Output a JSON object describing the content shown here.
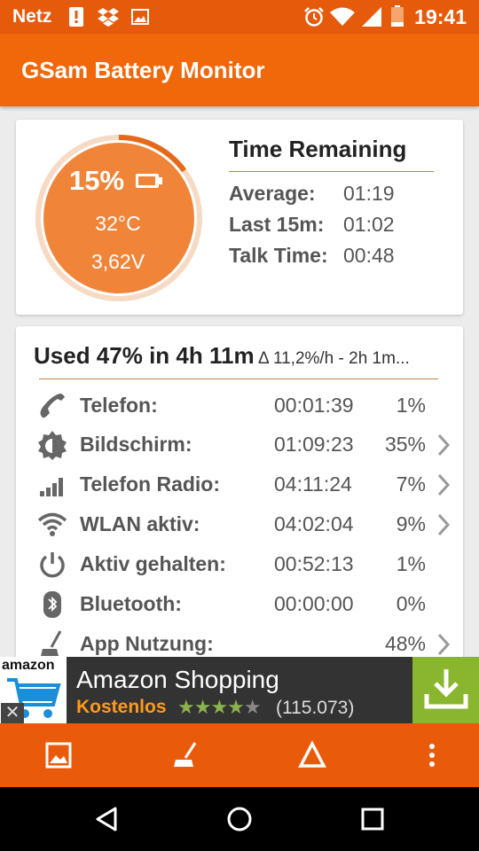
{
  "status_bar": {
    "carrier": "Netz",
    "time": "19:41"
  },
  "app_bar": {
    "title": "GSam Battery Monitor"
  },
  "battery": {
    "percent": "15%",
    "level_fraction": 0.15,
    "temperature": "32°C",
    "voltage": "3,62V"
  },
  "time_remaining": {
    "title": "Time Remaining",
    "rows": [
      {
        "label": "Average:",
        "value": "01:19"
      },
      {
        "label": "Last 15m:",
        "value": "01:02"
      },
      {
        "label": "Talk Time:",
        "value": "00:48"
      }
    ]
  },
  "usage": {
    "headline": "Used 47% in 4h 11m",
    "rate": "Δ 11,2%/h - 2h 1m...",
    "rows": [
      {
        "icon": "phone-icon",
        "label": "Telefon:",
        "time": "00:01:39",
        "percent": "1%",
        "chevron": false
      },
      {
        "icon": "brightness-icon",
        "label": "Bildschirm:",
        "time": "01:09:23",
        "percent": "35%",
        "chevron": true
      },
      {
        "icon": "signal-bars-icon",
        "label": "Telefon Radio:",
        "time": "04:11:24",
        "percent": "7%",
        "chevron": true
      },
      {
        "icon": "wifi-icon",
        "label": "WLAN aktiv:",
        "time": "04:02:04",
        "percent": "9%",
        "chevron": true
      },
      {
        "icon": "power-icon",
        "label": "Aktiv gehalten:",
        "time": "00:52:13",
        "percent": "1%",
        "chevron": false
      },
      {
        "icon": "bluetooth-icon",
        "label": "Bluetooth:",
        "time": "00:00:00",
        "percent": "0%",
        "chevron": false
      },
      {
        "icon": "broom-icon",
        "label": "App Nutzung:",
        "time": "",
        "percent": "48%",
        "chevron": true
      }
    ]
  },
  "ad": {
    "logo_text": "amazon",
    "app_name": "Amazon Shopping",
    "price": "Kostenlos",
    "stars": 4,
    "rating_count": "(115.073)",
    "close": "✕"
  },
  "bottom_bar": {
    "icons": [
      "image-icon",
      "broom-icon",
      "triangle-icon",
      "more-vert-icon"
    ]
  },
  "nav_bar": {
    "icons": [
      "back-icon",
      "home-icon",
      "recents-icon"
    ]
  },
  "colors": {
    "status_bar": "#e55a0b",
    "app_bar": "#f0680a",
    "gauge_fill": "#f0853a",
    "accent_line": "#c0823e",
    "ad_install": "#8ab52e"
  }
}
